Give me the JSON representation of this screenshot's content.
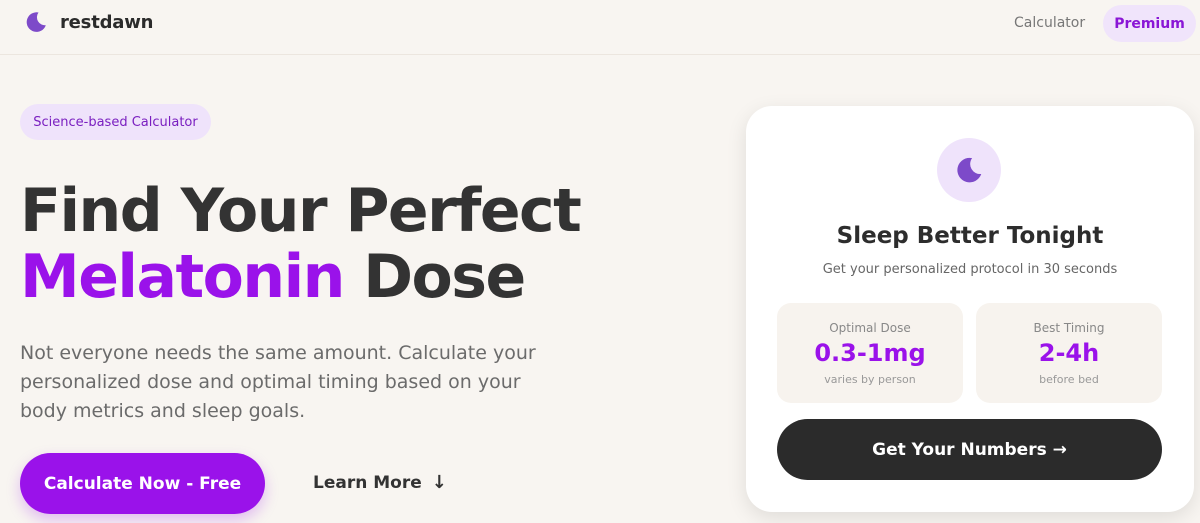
{
  "nav": {
    "logo_text": "restdawn",
    "logo_icon": "moon-icon",
    "calculator_link": "Calculator",
    "premium_button": "Premium"
  },
  "hero": {
    "badge": "Science-based Calculator",
    "title_line1": "Find Your Perfect",
    "title_accent": "Melatonin",
    "title_rest": " Dose",
    "subtitle": "Not everyone needs the same amount. Calculate your personalized dose and optimal timing based on your body metrics and sleep goals.",
    "primary_button": "Calculate Now - Free",
    "secondary_button": "Learn More",
    "secondary_arrow": "↓"
  },
  "card": {
    "icon": "moon-icon",
    "title": "Sleep Better Tonight",
    "subtitle": "Get your personalized protocol in 30 seconds",
    "stats": [
      {
        "label": "Optimal Dose",
        "value": "0.3-1mg",
        "note": "varies by person"
      },
      {
        "label": "Best Timing",
        "value": "2-4h",
        "note": "before bed"
      }
    ],
    "cta": "Get Your Numbers →"
  },
  "colors": {
    "accent": "#9a12ea",
    "background": "#f8f5f1",
    "dark": "#2b2b2b"
  }
}
